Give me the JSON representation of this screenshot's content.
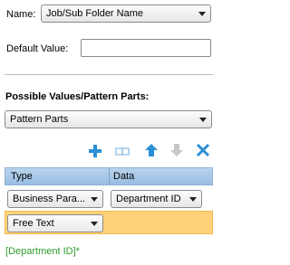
{
  "name_field": {
    "label": "Name:",
    "value": "Job/Sub Folder Name"
  },
  "default_value": {
    "label": "Default Value:",
    "value": ""
  },
  "possible_values": {
    "title": "Possible Values/Pattern Parts:",
    "selected": "Pattern Parts"
  },
  "toolbar": {
    "add_icon": "plus-icon",
    "duplicate_icon": "duplicate-icon",
    "up_icon": "arrow-up-icon",
    "down_icon": "arrow-down-icon",
    "delete_icon": "close-icon"
  },
  "grid": {
    "columns": [
      "Type",
      "Data"
    ],
    "rows": [
      {
        "type": "Business Para...",
        "data": "Department ID"
      },
      {
        "type": "Free Text",
        "data": ""
      }
    ]
  },
  "pattern_preview": "[Department ID]*",
  "colors": {
    "accent_blue": "#2a8fd6",
    "header_blue": "#a9c8e7",
    "selected_row": "#ffd27a",
    "preview_green": "#2e9a2e"
  }
}
